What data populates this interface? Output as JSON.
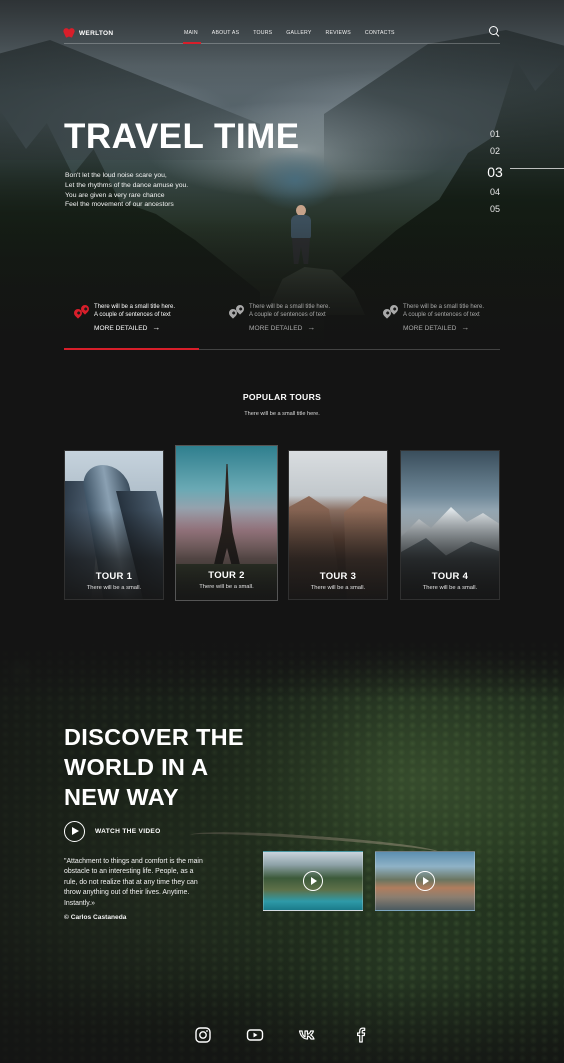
{
  "brand": {
    "name": "WERLTON",
    "accent": "#d81e2a"
  },
  "nav": {
    "items": [
      "MAIN",
      "ABOUT AS",
      "TOURS",
      "GALLERY",
      "REVIEWS",
      "CONTACTS"
    ],
    "active": "MAIN",
    "search_icon": "search-icon"
  },
  "hero": {
    "title": "TRAVEL TIME",
    "lines": [
      "Bon't let the loud noise scare you,",
      "Let the rhythms of the dance amuse you.",
      "You are given a very rare chance",
      "Feel the movement of our ancestors"
    ],
    "slides": [
      "01",
      "02",
      "03",
      "04",
      "05"
    ],
    "active_slide": "03",
    "features": [
      {
        "line1": "There will be a small title here.",
        "line2": "A couple of sentences of text",
        "more": "MORE DETAILED",
        "icon": "location-pins-icon"
      },
      {
        "line1": "There will be a small title here.",
        "line2": "A couple of sentences of text",
        "more": "MORE DETAILED",
        "icon": "location-pins-icon"
      },
      {
        "line1": "There will be a small title here.",
        "line2": "A couple of sentences of text",
        "more": "MORE DETAILED",
        "icon": "location-pins-icon"
      }
    ],
    "progress": 0.31
  },
  "popular": {
    "title": "POPULAR TOURS",
    "subtitle": "There will be a small title here.",
    "tours": [
      {
        "name": "TOUR 1",
        "text": "There will be a small."
      },
      {
        "name": "TOUR 2",
        "text": "There will be a small."
      },
      {
        "name": "TOUR 3",
        "text": "There will be a small."
      },
      {
        "name": "TOUR 4",
        "text": "There will be a small."
      }
    ]
  },
  "discover": {
    "title_lines": [
      "DISCOVER THE",
      "WORLD IN A",
      "NEW WAY"
    ],
    "watch_label": "WATCH THE VIDEO",
    "quote_lines": [
      "\"Attachment to things and comfort is the main",
      "obstacle to an interesting life. People, as a",
      "rule, do not realize that at any time they can",
      "throw anything out of their lives. Anytime.",
      "Instantly.»"
    ],
    "author": "© Carlos Castaneda"
  },
  "socials": [
    "instagram-icon",
    "youtube-icon",
    "vk-icon",
    "facebook-icon"
  ]
}
